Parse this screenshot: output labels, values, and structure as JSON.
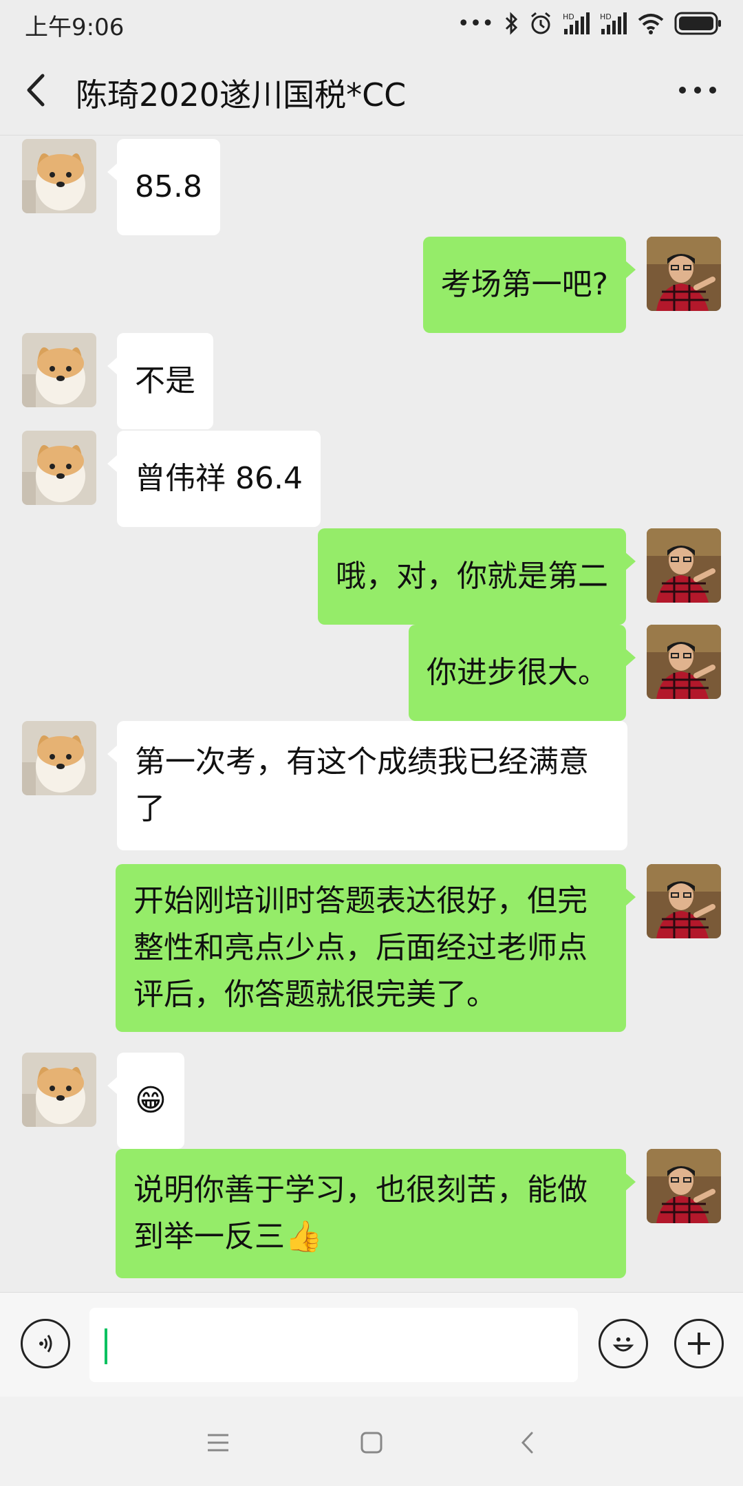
{
  "status_bar": {
    "time": "上午9:06",
    "battery_icon": "battery-icon",
    "wifi_icon": "wifi-icon"
  },
  "header": {
    "title": "陈琦2020遂川国税*CC",
    "back_icon": "chevron-left-icon",
    "more_icon": "more-dots-icon"
  },
  "messages": [
    {
      "side": "left",
      "text": "85.8"
    },
    {
      "side": "right",
      "text": "考场第一吧?"
    },
    {
      "side": "left",
      "text": "不是"
    },
    {
      "side": "left",
      "text": "曾伟祥 86.4"
    },
    {
      "side": "right",
      "text": "哦，对，你就是第二"
    },
    {
      "side": "right",
      "text": "你进步很大。"
    },
    {
      "side": "left",
      "text": "第一次考，有这个成绩我已经满意了"
    },
    {
      "side": "right",
      "text": "开始刚培训时答题表达很好，但完整性和亮点少点，后面经过老师点评后，你答题就很完美了。"
    },
    {
      "side": "left",
      "text": "😁"
    },
    {
      "side": "right",
      "text": "说明你善于学习，也很刻苦，能做到举一反三👍"
    }
  ],
  "input_bar": {
    "value": "",
    "voice_icon": "voice-icon",
    "emoji_icon": "emoji-icon",
    "plus_icon": "plus-icon"
  },
  "nav_bar": {
    "menu_icon": "menu-icon",
    "home_icon": "home-icon",
    "back_icon": "back-icon"
  },
  "colors": {
    "background": "#ededed",
    "self_bubble": "#95ec69",
    "other_bubble": "#ffffff",
    "accent": "#07c160"
  }
}
